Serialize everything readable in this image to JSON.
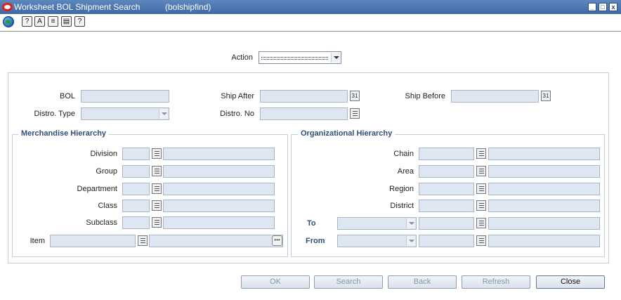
{
  "window": {
    "title": "Worksheet BOL Shipment Search",
    "form_id": "(bolshipfind)",
    "minimize": "_",
    "maximize": "□",
    "close": "x"
  },
  "toolbar": {
    "icons": [
      "globe-icon",
      "help-topics-icon",
      "spell-icon",
      "notes-icon",
      "print-icon",
      "help-icon"
    ]
  },
  "action": {
    "label": "Action",
    "value": ""
  },
  "criteria": {
    "bol_label": "BOL",
    "ship_after_label": "Ship After",
    "ship_before_label": "Ship Before",
    "distro_type_label": "Distro. Type",
    "distro_no_label": "Distro. No"
  },
  "merch": {
    "title": "Merchandise Hierarchy",
    "division_label": "Division",
    "group_label": "Group",
    "department_label": "Department",
    "class_label": "Class",
    "subclass_label": "Subclass",
    "item_label": "Item"
  },
  "org": {
    "title": "Organizational Hierarchy",
    "chain_label": "Chain",
    "area_label": "Area",
    "region_label": "Region",
    "district_label": "District",
    "to_label": "To",
    "from_label": "From"
  },
  "buttons": {
    "ok": "OK",
    "search": "Search",
    "back": "Back",
    "refresh": "Refresh",
    "close": "Close"
  },
  "colors": {
    "title_bar": "#4a76b0",
    "field_fill": "#dde6f1",
    "group_title": "#2f4f7f"
  }
}
